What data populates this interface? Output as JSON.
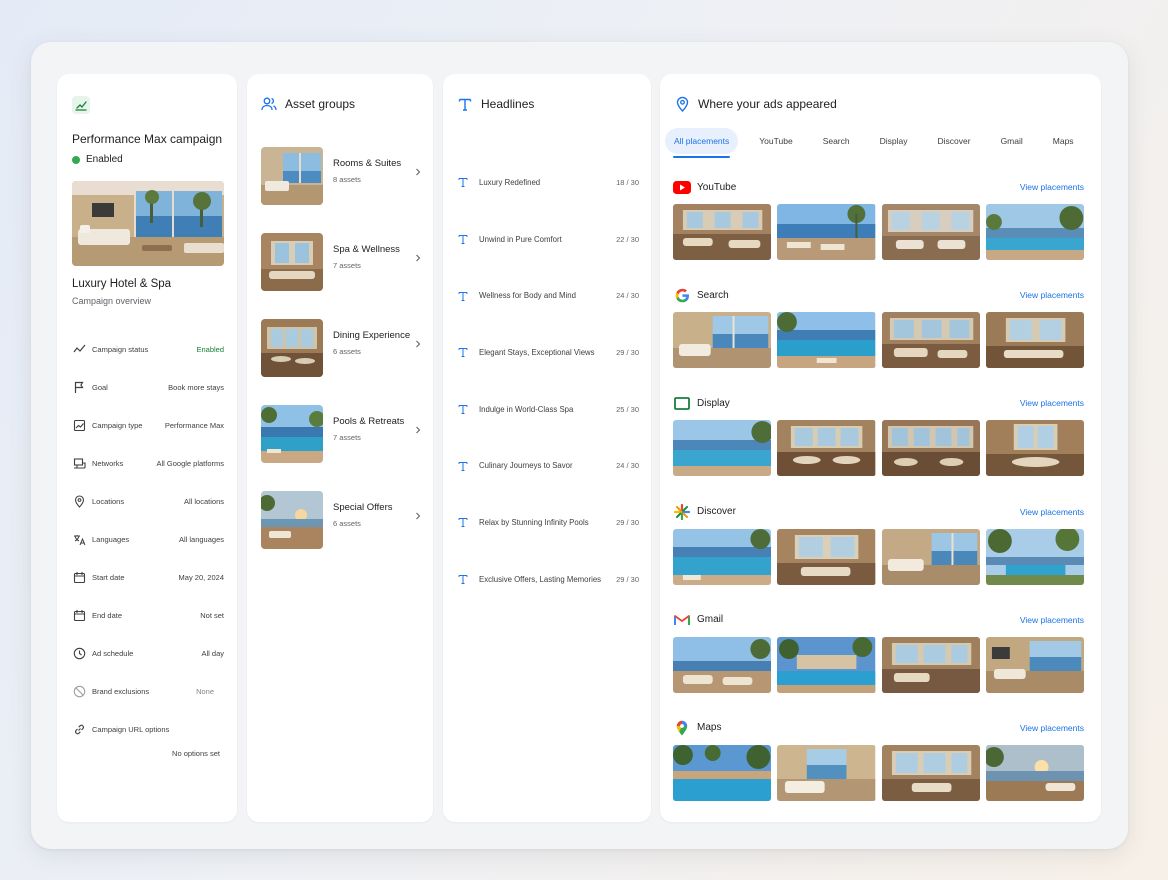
{
  "campaign": {
    "title": "Performance Max campaign",
    "status": "Enabled",
    "hotel_name": "Luxury Hotel & Spa",
    "subtitle": "Campaign overview",
    "settings": [
      {
        "icon": "trend-icon",
        "label": "Campaign status",
        "value": "Enabled"
      },
      {
        "icon": "flag-icon",
        "label": "Goal",
        "value": "Book more stays"
      },
      {
        "icon": "chart-icon",
        "label": "Campaign type",
        "value": "Performance Max"
      },
      {
        "icon": "network-icon",
        "label": "Networks",
        "value": "All Google platforms"
      },
      {
        "icon": "location-icon",
        "label": "Locations",
        "value": "All locations"
      },
      {
        "icon": "translate-icon",
        "label": "Languages",
        "value": "All languages"
      },
      {
        "icon": "calendar-icon",
        "label": "Start date",
        "value": "May 20, 2024"
      },
      {
        "icon": "calendar-icon",
        "label": "End date",
        "value": "Not set"
      },
      {
        "icon": "clock-icon",
        "label": "Ad schedule",
        "value": "All day"
      },
      {
        "icon": "block-icon",
        "label": "Brand exclusions",
        "value": "None"
      },
      {
        "icon": "link-icon",
        "label": "Campaign URL options",
        "value": ""
      }
    ],
    "url_options_value": "No options set"
  },
  "asset_groups": {
    "title": "Asset groups",
    "items": [
      {
        "name": "Rooms & Suites",
        "count": "8 assets"
      },
      {
        "name": "Spa & Wellness",
        "count": "7 assets"
      },
      {
        "name": "Dining Experience",
        "count": "6 assets"
      },
      {
        "name": "Pools & Retreats",
        "count": "7 assets"
      },
      {
        "name": "Special Offers",
        "count": "6 assets"
      }
    ]
  },
  "headlines": {
    "title": "Headlines",
    "items": [
      {
        "text": "Luxury Redefined",
        "count": "18 / 30"
      },
      {
        "text": "Unwind in Pure Comfort",
        "count": "22 / 30"
      },
      {
        "text": "Wellness for Body and Mind",
        "count": "24 / 30"
      },
      {
        "text": "Elegant Stays, Exceptional Views",
        "count": "29 / 30"
      },
      {
        "text": "Indulge in World-Class Spa",
        "count": "25 / 30"
      },
      {
        "text": "Culinary Journeys to Savor",
        "count": "24 / 30"
      },
      {
        "text": "Relax by Stunning Infinity Pools",
        "count": "29 / 30"
      },
      {
        "text": "Exclusive Offers, Lasting Memories",
        "count": "29 / 30"
      }
    ]
  },
  "placements": {
    "title": "Where your ads appeared",
    "tabs": [
      "All placements",
      "YouTube",
      "Search",
      "Display",
      "Discover",
      "Gmail",
      "Maps"
    ],
    "active_tab": "All placements",
    "view_label": "View placements",
    "sections": [
      {
        "name": "YouTube",
        "logo": "youtube-logo-icon"
      },
      {
        "name": "Search",
        "logo": "google-g-logo-icon"
      },
      {
        "name": "Display",
        "logo": "display-logo-icon"
      },
      {
        "name": "Discover",
        "logo": "discover-logo-icon"
      },
      {
        "name": "Gmail",
        "logo": "gmail-logo-icon"
      },
      {
        "name": "Maps",
        "logo": "maps-pin-logo-icon"
      }
    ]
  },
  "colors": {
    "accent": "#1a73e8",
    "status_green": "#188038",
    "enabled_dot": "#34a853"
  }
}
